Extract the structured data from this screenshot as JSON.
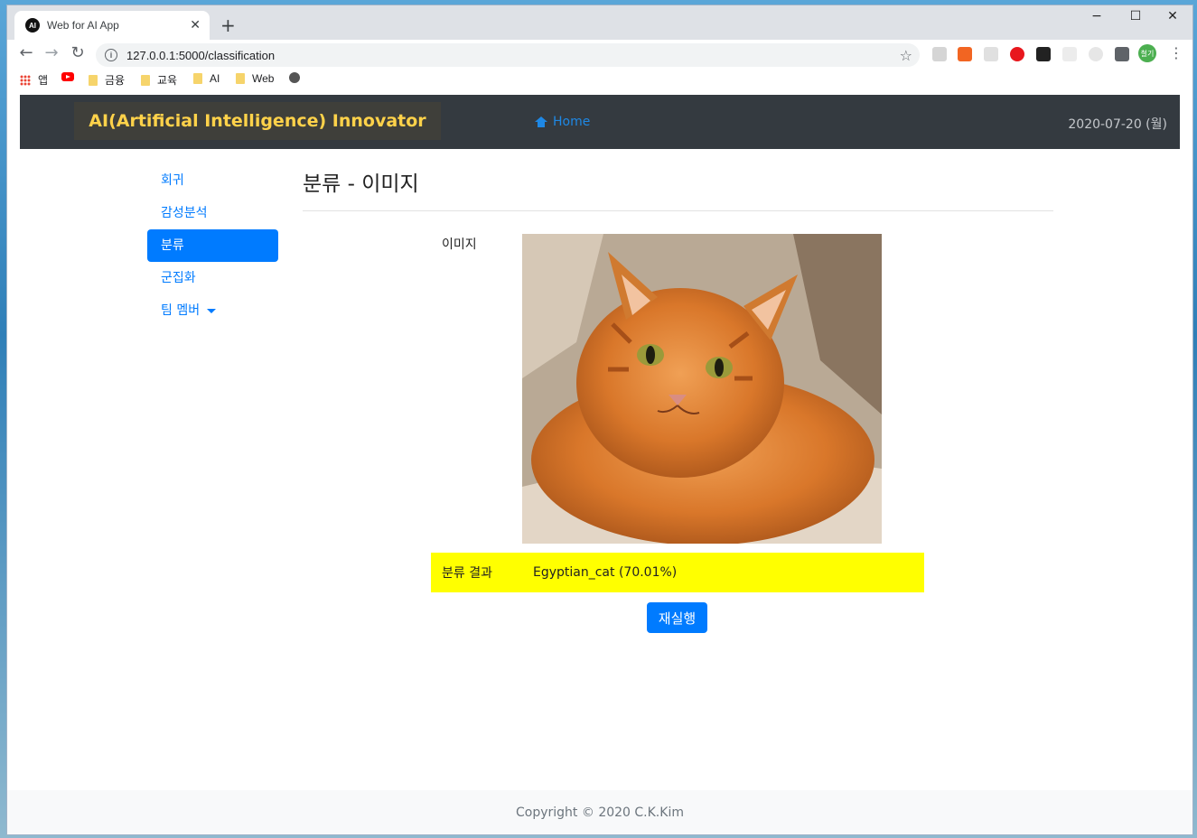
{
  "browser": {
    "tab_title": "Web for AI App",
    "tab_favicon_text": "AI",
    "url": "127.0.0.1:5000/classification",
    "window_controls": [
      "−",
      "☐",
      "✕"
    ],
    "profile_initials": "철기",
    "bookmarks": [
      {
        "label": "앱",
        "icon": "apps-grid-icon"
      },
      {
        "label": "",
        "icon": "youtube-icon"
      },
      {
        "label": "금융",
        "icon": "folder-icon"
      },
      {
        "label": "교육",
        "icon": "folder-icon"
      },
      {
        "label": "AI",
        "icon": "folder-icon"
      },
      {
        "label": "Web",
        "icon": "folder-icon"
      },
      {
        "label": "",
        "icon": "globe-icon"
      }
    ]
  },
  "navbar": {
    "brand": "AI(Artificial Intelligence) Innovator",
    "home": "Home",
    "date": "2020-07-20 (월)"
  },
  "sidebar": {
    "items": [
      {
        "label": "회귀",
        "active": false
      },
      {
        "label": "감성분석",
        "active": false
      },
      {
        "label": "분류",
        "active": true
      },
      {
        "label": "군집화",
        "active": false
      },
      {
        "label": "팀 멤버",
        "active": false,
        "dropdown": true
      }
    ]
  },
  "main": {
    "title": "분류 - 이미지",
    "image_label": "이미지",
    "result_label": "분류 결과",
    "result_value": "Egyptian_cat (70.01%)",
    "rerun_button": "재실행"
  },
  "footer": {
    "text": "Copyright © 2020 C.K.Kim"
  }
}
